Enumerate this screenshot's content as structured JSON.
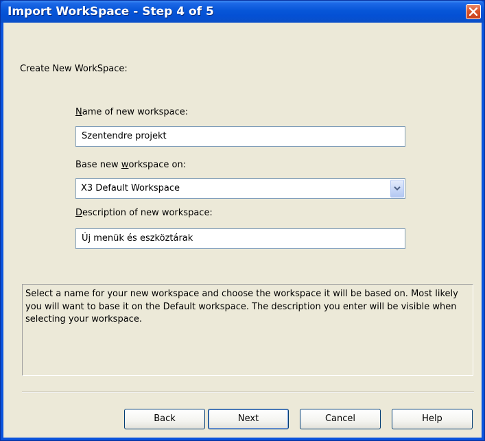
{
  "window": {
    "title": "Import WorkSpace - Step 4 of 5"
  },
  "section": {
    "heading": "Create New WorkSpace:"
  },
  "form": {
    "name_label_access": "N",
    "name_label_rest": "ame of new workspace:",
    "name_value": "Szentendre projekt",
    "base_label_pre": "Base new ",
    "base_label_access": "w",
    "base_label_rest": "orkspace on:",
    "base_value": "X3 Default Workspace",
    "desc_label_access": "D",
    "desc_label_rest": "escription of new workspace:",
    "desc_value": "Új menük és eszköztárak"
  },
  "help_text": "Select a name for your new workspace and choose the workspace it will be based on. Most likely you will want to base it on the Default workspace. The description you enter will be visible when selecting your workspace.",
  "buttons": {
    "back": "Back",
    "next": "Next",
    "cancel": "Cancel",
    "help": "Help"
  },
  "colors": {
    "titlebar": "#0450d4",
    "dialog_face": "#ece9d8",
    "close_button": "#d9542a",
    "field_border": "#7f9db9"
  },
  "icons": {
    "close": "close-x-icon",
    "dropdown": "chevron-down-icon"
  }
}
